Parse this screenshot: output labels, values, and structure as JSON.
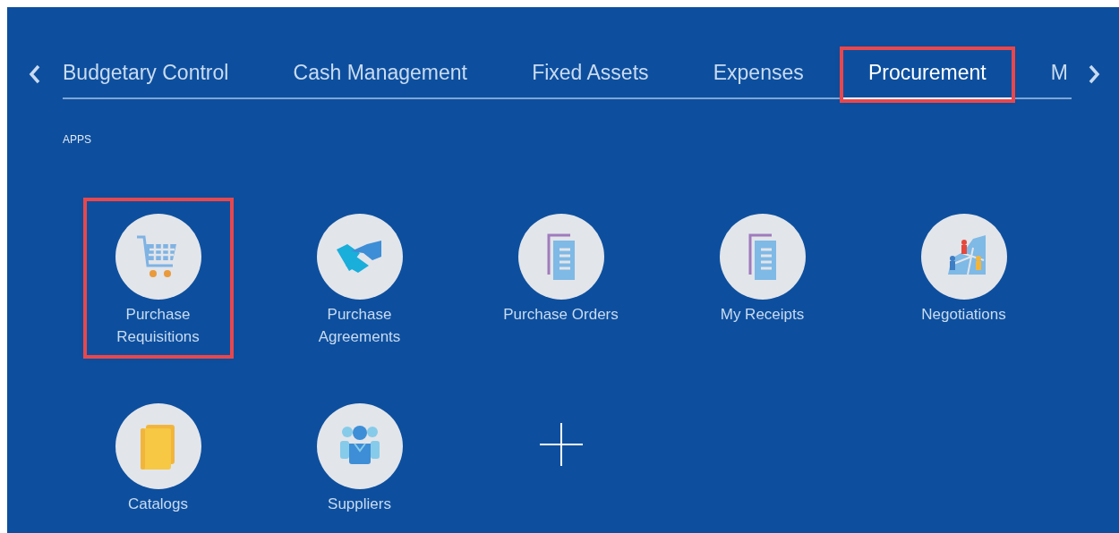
{
  "tabs": [
    {
      "label": "Budgetary Control",
      "selected": false,
      "highlighted": false
    },
    {
      "label": "Cash Management",
      "selected": false,
      "highlighted": false
    },
    {
      "label": "Fixed Assets",
      "selected": false,
      "highlighted": false
    },
    {
      "label": "Expenses",
      "selected": false,
      "highlighted": false
    },
    {
      "label": "Procurement",
      "selected": true,
      "highlighted": true
    },
    {
      "label": "M",
      "selected": false,
      "highlighted": false
    }
  ],
  "section_title": "APPS",
  "apps": [
    {
      "label": "Purchase Requisitions",
      "kind": "cart",
      "highlighted": true
    },
    {
      "label": "Purchase Agreements",
      "kind": "handshake",
      "highlighted": false
    },
    {
      "label": "Purchase Orders",
      "kind": "document",
      "highlighted": false
    },
    {
      "label": "My Receipts",
      "kind": "document",
      "highlighted": false
    },
    {
      "label": "Negotiations",
      "kind": "map",
      "highlighted": false
    },
    {
      "label": "Catalogs",
      "kind": "folder",
      "highlighted": false
    },
    {
      "label": "Suppliers",
      "kind": "people",
      "highlighted": false
    },
    {
      "kind": "add"
    }
  ]
}
